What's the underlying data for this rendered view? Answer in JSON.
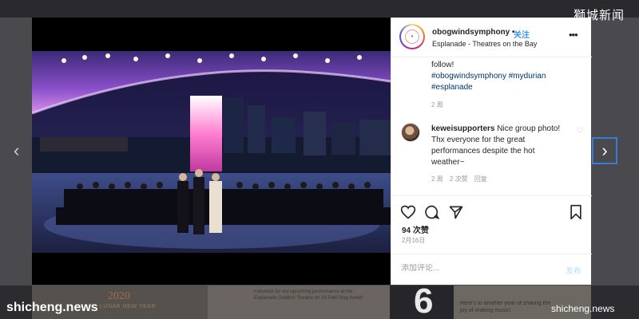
{
  "post": {
    "username": "obogwindsymphony",
    "separator": "•",
    "follow_label": "关注",
    "location": "Esplanade - Theatres on the Bay",
    "more_icon": "more-horizontal-icon"
  },
  "caption": {
    "text": "follow!",
    "hashtags": [
      "#obogwindsymphony",
      "#mydurian",
      "#esplanade"
    ],
    "time": "2 周"
  },
  "comment": {
    "user": "keweisupporters",
    "text": "Nice group photo! Thx everyone for the great performances despite the hot weather~",
    "time": "2 周",
    "likes": "2 次赞",
    "reply": "回复"
  },
  "actions": {
    "likes": "94 次赞",
    "date": "2月16日",
    "comment_placeholder": "添加评论...",
    "post_label": "发布"
  },
  "background": {
    "tile_year": "2020",
    "tile_sub": "LUNAR NEW YEAR",
    "tile_text": "Fabulous for our upcoming performance at the Esplanade Outdoor Theatre on 16 Feb! Stay tuned!",
    "tile_glyph": "6",
    "tile_text2": "Here's to another year of sharing the joy of making music!"
  },
  "watermarks": {
    "top_right": "獅城新闻",
    "bottom_left": "shicheng.news",
    "bottom_right": "shicheng.news"
  },
  "nav": {
    "prev": "‹",
    "next": "›"
  },
  "colors": {
    "link": "#3897f0",
    "hashtag": "#003569",
    "stage_lights": "#c17be6"
  }
}
